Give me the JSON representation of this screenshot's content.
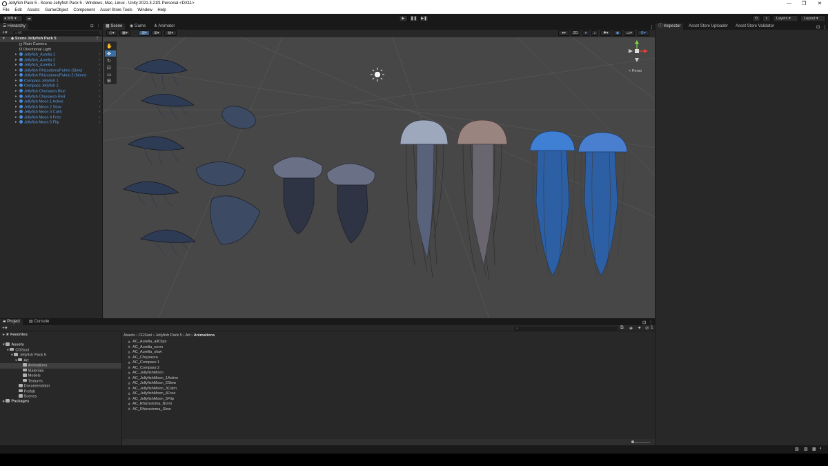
{
  "window": {
    "title": "Jellyfish Pack 5 - Scene Jellyfish Pack 5 - Windows, Mac, Linux - Unity 2021.3.21f1 Personal <DX11>",
    "controls": [
      "—",
      "❐",
      "✕"
    ]
  },
  "menu": [
    "File",
    "Edit",
    "Assets",
    "GameObject",
    "Component",
    "Asset Store Tools",
    "Window",
    "Help"
  ],
  "toolbar": {
    "account": "MN",
    "layers": "Layers",
    "layout": "Layout"
  },
  "hierarchy": {
    "tab": "Hierarchy",
    "search_placeholder": "All",
    "scene": "Scene Jellyfish Pack 5",
    "items": [
      {
        "label": "Main Camera",
        "blue": false
      },
      {
        "label": "Directional Light",
        "blue": false
      },
      {
        "label": "Jellyfish_Aurelia 1",
        "blue": true
      },
      {
        "label": "Jellyfish_Aurelia 2",
        "blue": true
      },
      {
        "label": "Jellyfish_Aurelia 3",
        "blue": true
      },
      {
        "label": "Jellyfish RhizostomaPulmo (Slow)",
        "blue": true
      },
      {
        "label": "Jellyfish RhizostomaPulmo 2 (Norm)",
        "blue": true
      },
      {
        "label": "Compass Jellyfish 1",
        "blue": true
      },
      {
        "label": "Compass Jellyfish 2",
        "blue": true
      },
      {
        "label": "Jellyfish Chrysaora Blue",
        "blue": true
      },
      {
        "label": "Jellyfish Chrysaora Red",
        "blue": true
      },
      {
        "label": "Jellyfish Moon 1 Active",
        "blue": true
      },
      {
        "label": "Jellyfish Moon 2 Slow",
        "blue": true
      },
      {
        "label": "Jellyfish Moon 3 Calm",
        "blue": true
      },
      {
        "label": "Jellyfish Moon 4 Free",
        "blue": true
      },
      {
        "label": "Jellyfish Moon 5 Flip",
        "blue": true
      }
    ]
  },
  "scene_view": {
    "tabs": [
      "Scene",
      "Game",
      "Animator"
    ],
    "mode_2d": "2D",
    "persp": "< Persp"
  },
  "inspector": {
    "tabs": [
      "Inspector",
      "Asset Store Uploader",
      "Asset Store Validator"
    ]
  },
  "project": {
    "tabs": [
      "Project",
      "Console"
    ],
    "favorites": "Favorites",
    "tree": [
      {
        "label": "Assets",
        "level": 0,
        "bold": true
      },
      {
        "label": "CGSoul",
        "level": 1
      },
      {
        "label": "Jellyfish Pack 5",
        "level": 2
      },
      {
        "label": "Art",
        "level": 3
      },
      {
        "label": "Animations",
        "level": 4,
        "selected": true
      },
      {
        "label": "Materials",
        "level": 4
      },
      {
        "label": "Models",
        "level": 4
      },
      {
        "label": "Textures",
        "level": 4
      },
      {
        "label": "Documentation",
        "level": 3
      },
      {
        "label": "Prefab",
        "level": 3
      },
      {
        "label": "Scenes",
        "level": 3
      }
    ],
    "packages": "Packages",
    "breadcrumb": [
      "Assets",
      "CGSoul",
      "Jellyfish Pack 5",
      "Art",
      "Animations"
    ],
    "files": [
      "AC_Aurelia_allClips",
      "AC_Aurelia_norm",
      "AC_Aurelia_slow",
      "AC_Chrysaora",
      "AC_Compass 1",
      "AC_Compass 2",
      "AC_JellyfishMoon",
      "AC_JellyfishMoon_1Active",
      "AC_JellyfishMoon_2Slow",
      "AC_JellyfishMoon_3Calm",
      "AC_JellyfishMoon_4Free",
      "AC_JellyfishMoon_5Flip",
      "AC_Rhizostoma_Norm",
      "AC_Rhizostoma_Slow"
    ],
    "hidden_count": "1"
  },
  "colors": {
    "accent_blue": "#5b9fea",
    "selection": "#2c5d87",
    "panel": "#282828",
    "viewport": "#474747"
  }
}
